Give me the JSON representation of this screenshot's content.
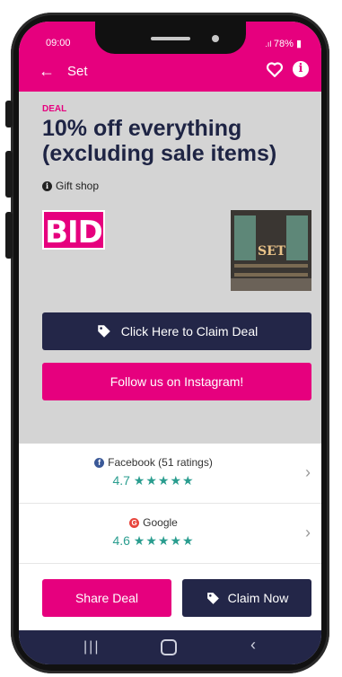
{
  "status": {
    "time": "09:00",
    "battery": "78%"
  },
  "nav": {
    "title": "Set"
  },
  "deal": {
    "label": "DEAL",
    "title": "10% off everything (excluding sale items)",
    "category": "Gift shop"
  },
  "brand": {
    "logo_text": "BID",
    "photo_sign": "SET"
  },
  "buttons": {
    "claim_deal": "Click Here to Claim Deal",
    "instagram": "Follow us on Instagram!",
    "share": "Share Deal",
    "claim_now": "Claim Now"
  },
  "ratings": [
    {
      "source": "Facebook (51 ratings)",
      "value": "4.7",
      "stars": "★★★★★"
    },
    {
      "source": "Google",
      "value": "4.6",
      "stars": "★★★★★"
    }
  ],
  "colors": {
    "accent": "#e6007e",
    "navy": "#232648",
    "rating": "#2a9d8f"
  }
}
